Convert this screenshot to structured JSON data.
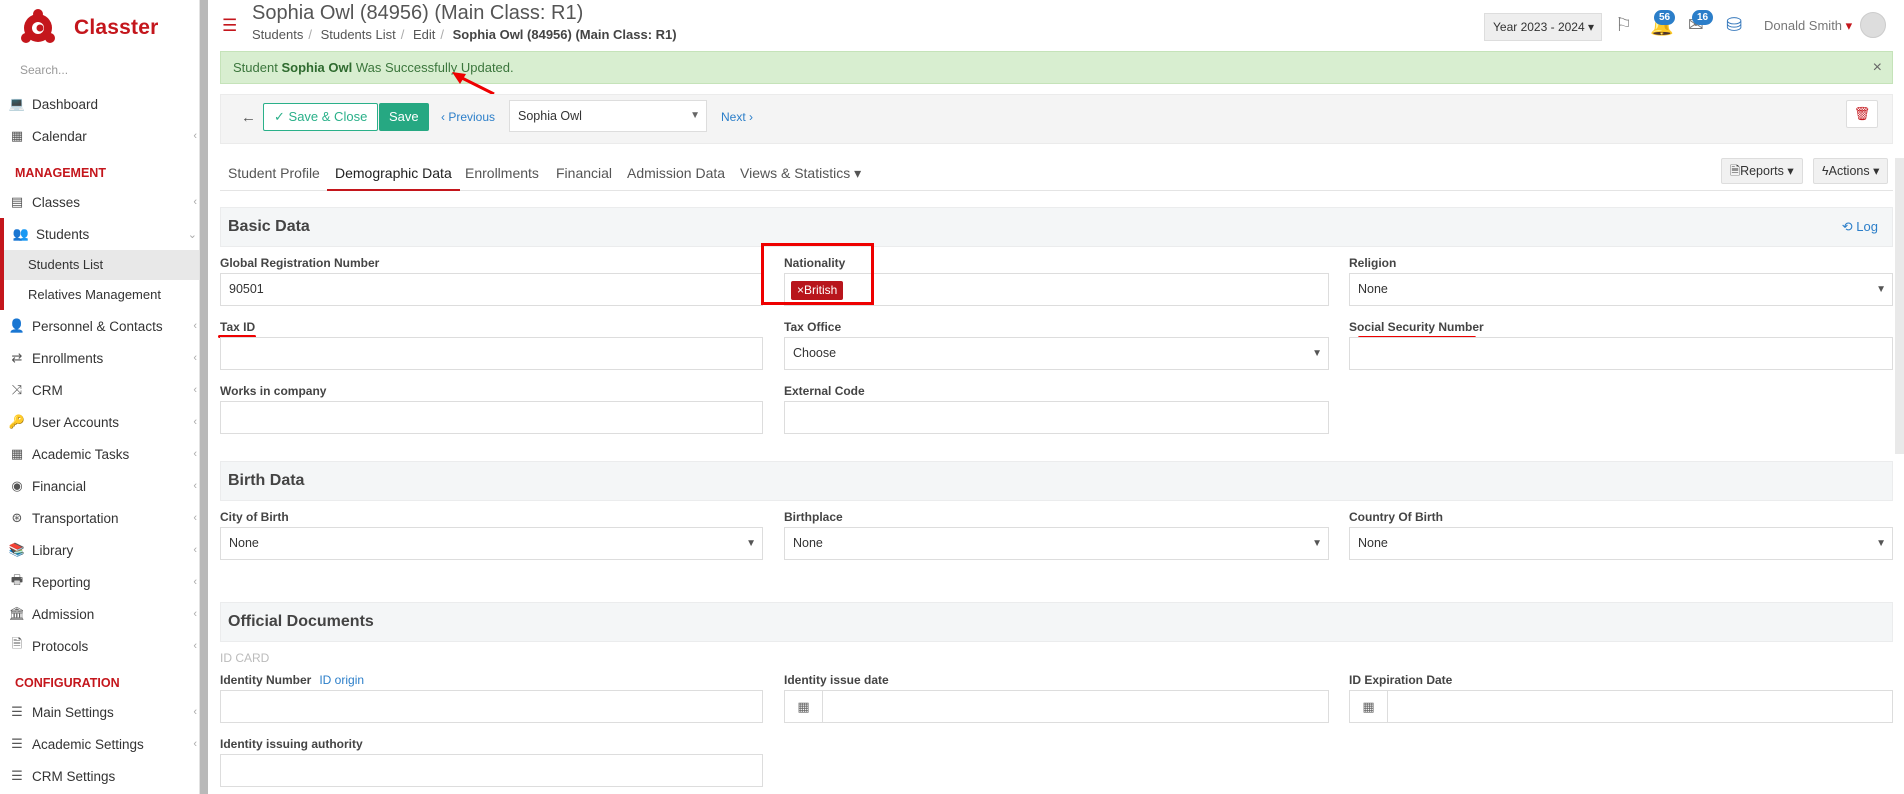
{
  "app": {
    "name": "Classter",
    "search_placeholder": "Search..."
  },
  "sidebar": {
    "items_top": [
      {
        "label": "Dashboard",
        "icon": "laptop-icon"
      },
      {
        "label": "Calendar",
        "icon": "calendar-icon"
      }
    ],
    "section_management": "MANAGEMENT",
    "management_items": [
      {
        "label": "Classes",
        "icon": "classes-icon"
      },
      {
        "label": "Students",
        "icon": "students-icon"
      }
    ],
    "students_sub": [
      "Students List",
      "Relatives Management"
    ],
    "management_items_2": [
      {
        "label": "Personnel & Contacts"
      },
      {
        "label": "Enrollments"
      },
      {
        "label": "CRM"
      },
      {
        "label": "User Accounts"
      },
      {
        "label": "Academic Tasks"
      },
      {
        "label": "Financial"
      },
      {
        "label": "Transportation"
      },
      {
        "label": "Library"
      },
      {
        "label": "Reporting"
      },
      {
        "label": "Admission"
      },
      {
        "label": "Protocols"
      }
    ],
    "section_configuration": "CONFIGURATION",
    "config_items": [
      {
        "label": "Main Settings"
      },
      {
        "label": "Academic Settings"
      },
      {
        "label": "CRM Settings"
      }
    ]
  },
  "header": {
    "title": "Sophia Owl (84956) (Main Class: R1)",
    "breadcrumb": [
      "Students",
      "Students List",
      "Edit",
      "Sophia Owl (84956) (Main Class: R1)"
    ],
    "year": "Year 2023 - 2024",
    "notifications_count": "56",
    "messages_count": "16",
    "user": "Donald Smith"
  },
  "alert": {
    "prefix": "Student",
    "name": "Sophia Owl",
    "suffix": "Was Successfully Updated.",
    "close": "×"
  },
  "toolbar": {
    "save_close": "Save & Close",
    "save": "Save",
    "previous": "Previous",
    "student": "Sophia Owl",
    "next": "Next"
  },
  "tabs": [
    "Student Profile",
    "Demographic Data",
    "Enrollments",
    "Financial",
    "Admission Data",
    "Views & Statistics"
  ],
  "tab_buttons": {
    "reports": "Reports",
    "actions": "Actions"
  },
  "basic": {
    "title": "Basic Data",
    "log": "Log",
    "global_reg_label": "Global Registration Number",
    "global_reg_value": "90501",
    "nationality_label": "Nationality",
    "nationality_tag": "British",
    "religion_label": "Religion",
    "religion_value": "None",
    "tax_id_label": "Tax ID",
    "tax_office_label": "Tax Office",
    "tax_office_value": "Choose",
    "ssn_label": "Social Security Number",
    "works_label": "Works in company",
    "external_label": "External Code"
  },
  "birth": {
    "title": "Birth Data",
    "city_label": "City of Birth",
    "city_value": "None",
    "place_label": "Birthplace",
    "place_value": "None",
    "country_label": "Country Of Birth",
    "country_value": "None"
  },
  "official": {
    "title": "Official Documents",
    "id_card": "ID CARD",
    "identity_label": "Identity Number",
    "id_origin": "ID origin",
    "issue_date_label": "Identity issue date",
    "expiry_label": "ID Expiration Date",
    "authority_label": "Identity issuing authority"
  },
  "colors": {
    "brand": "#c4161c",
    "accent": "#26a882",
    "link": "#2b7ec9"
  }
}
